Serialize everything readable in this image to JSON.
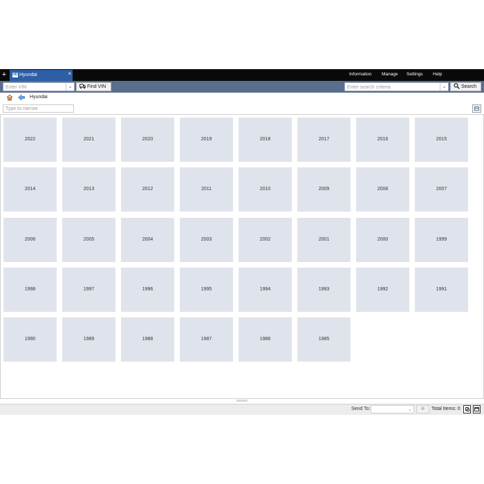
{
  "titlebar": {
    "new_tab_symbol": "+",
    "tab": {
      "logo_text": "HD",
      "label": "Hyundai",
      "close_symbol": "×"
    },
    "menu": [
      "Information",
      "Manage",
      "Settings",
      "Help"
    ]
  },
  "toolbar": {
    "vin_placeholder": "Enter VIN",
    "find_vin_label": "Find VIN",
    "search_placeholder": "Enter search criteria",
    "search_label": "Search"
  },
  "breadcrumb": {
    "label": "Hyundai"
  },
  "filter": {
    "placeholder": "Type to narrow"
  },
  "years": [
    "2022",
    "2021",
    "2020",
    "2019",
    "2018",
    "2017",
    "2016",
    "2015",
    "2014",
    "2013",
    "2012",
    "2011",
    "2010",
    "2009",
    "2008",
    "2007",
    "2006",
    "2005",
    "2004",
    "2003",
    "2002",
    "2001",
    "2000",
    "1999",
    "1998",
    "1997",
    "1996",
    "1995",
    "1994",
    "1993",
    "1992",
    "1991",
    "1990",
    "1989",
    "1988",
    "1987",
    "1986",
    "1985"
  ],
  "status": {
    "send_to_label": "Send To:",
    "send_symbol": "⊕",
    "total_items": "Total Items: 0"
  },
  "icons": {
    "home": "home-icon",
    "back": "back-arrow-icon",
    "find_vin": "truck-icon",
    "search": "magnifier-icon",
    "view_toggle": "list-view-icon",
    "restore": "restore-window-icon",
    "maximize": "maximize-window-icon"
  },
  "colors": {
    "titlebar": "#0a0a0a",
    "tab": "#2d5fa6",
    "toolbar": "#5a6e8d",
    "tile": "#dfe4ec"
  }
}
